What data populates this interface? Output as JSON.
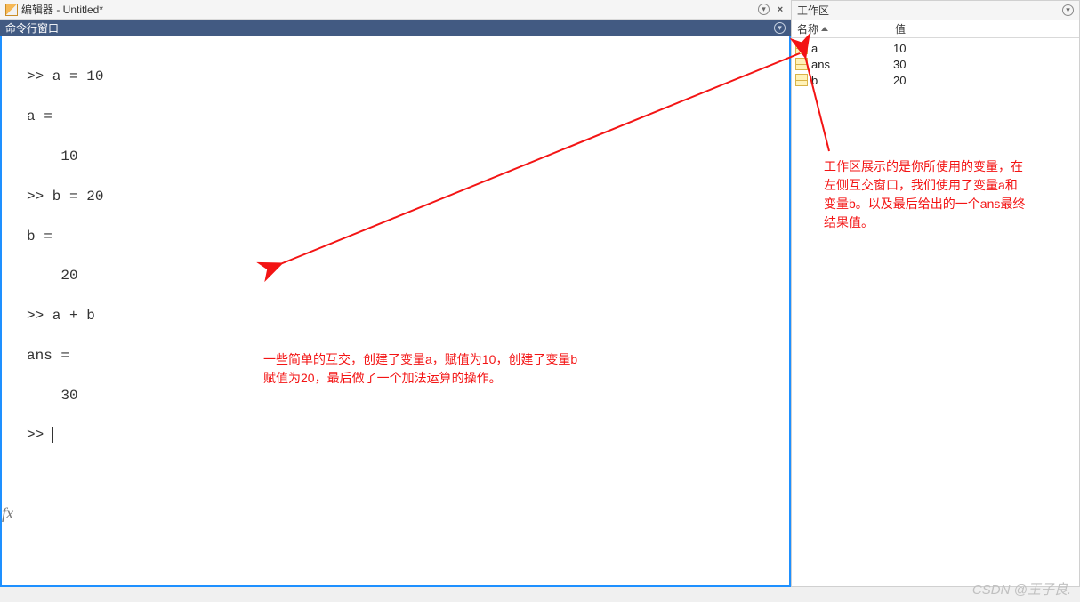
{
  "editor": {
    "title": "编辑器 - Untitled*"
  },
  "cmd": {
    "header": "命令行窗口",
    "lines": {
      "l1": ">> a = 10",
      "l2": "",
      "l3": "a =",
      "l4": "",
      "l5": "    10",
      "l6": "",
      "l7": ">> b = 20",
      "l8": "",
      "l9": "b =",
      "l10": "",
      "l11": "    20",
      "l12": "",
      "l13": ">> a + b",
      "l14": "",
      "l15": "ans =",
      "l16": "",
      "l17": "    30",
      "l18": "",
      "prompt": ">> "
    },
    "fx": "fx"
  },
  "workspace": {
    "title": "工作区",
    "col_name": "名称",
    "col_value": "值",
    "rows": [
      {
        "name": "a",
        "value": "10"
      },
      {
        "name": "ans",
        "value": "30"
      },
      {
        "name": "b",
        "value": "20"
      }
    ]
  },
  "annotations": {
    "left": "一些简单的互交，创建了变量a，赋值为10，创建了变量b\n赋值为20，最后做了一个加法运算的操作。",
    "right": "工作区展示的是你所使用的变量，在\n左侧互交窗口，我们使用了变量a和\n变量b。以及最后给出的一个ans最终\n结果值。"
  },
  "watermark": "CSDN @王子良."
}
